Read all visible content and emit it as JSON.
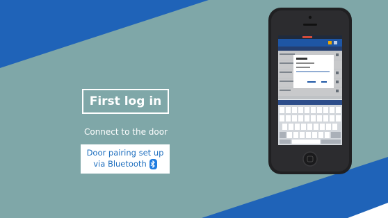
{
  "slide": {
    "title": "First log in",
    "subtitle": "Connect to the door",
    "pairing_line1": "Door pairing set up",
    "pairing_line2": "via Bluetooth"
  },
  "icons": {
    "bluetooth": "bluetooth-icon"
  },
  "colors": {
    "background": "#7fa7a8",
    "band_blue": "#1f63b8",
    "accent_text": "#1f6fbf",
    "white": "#ffffff"
  }
}
